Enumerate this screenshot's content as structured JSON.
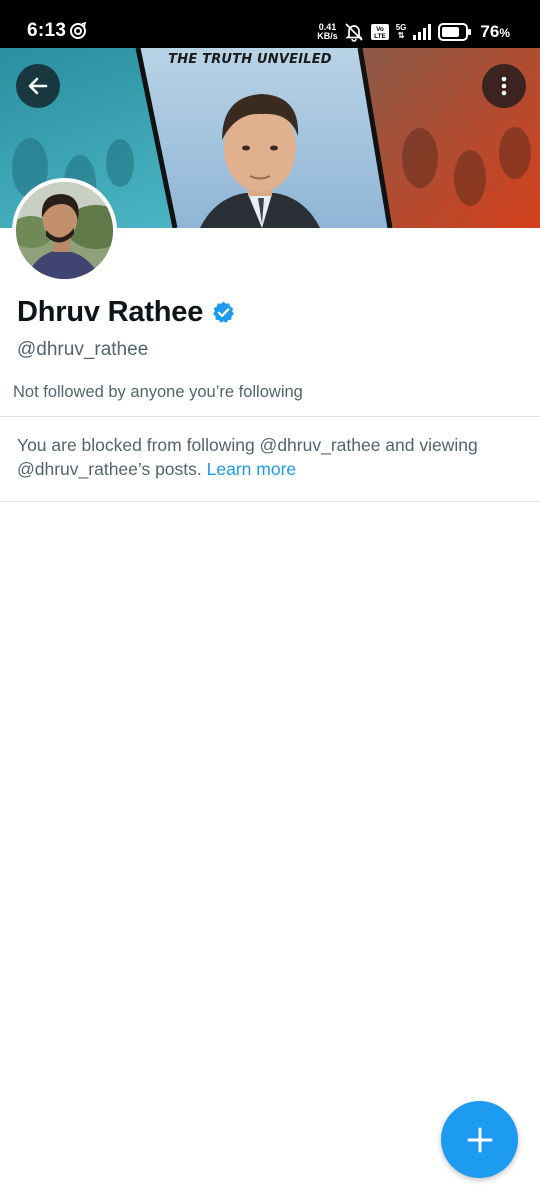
{
  "status_bar": {
    "time": "6:13",
    "net_speed_value": "0.41",
    "net_speed_unit": "KB/s",
    "network_type": "5G",
    "battery_percent": "76",
    "battery_level": 0.76,
    "icons": [
      "app-notification-icon",
      "mute-icon",
      "volte-icon",
      "signal-icon",
      "battery-icon"
    ]
  },
  "banner": {
    "caption": "THE TRUTH UNVEILED"
  },
  "header": {
    "back_icon": "arrow-left-icon",
    "more_icon": "more-vertical-icon"
  },
  "profile": {
    "display_name": "Dhruv Rathee",
    "verified": true,
    "handle": "@dhruv_rathee",
    "followed_by_note": "Not followed by anyone you’re following"
  },
  "blocked_notice": {
    "message": "You are blocked from following @dhruv_rathee and viewing @dhruv_rathee’s posts.",
    "link_label": "Learn more"
  },
  "fab": {
    "icon": "plus-icon"
  },
  "colors": {
    "accent": "#1d9bf0",
    "text_primary": "#0f1419",
    "text_secondary": "#536471"
  }
}
